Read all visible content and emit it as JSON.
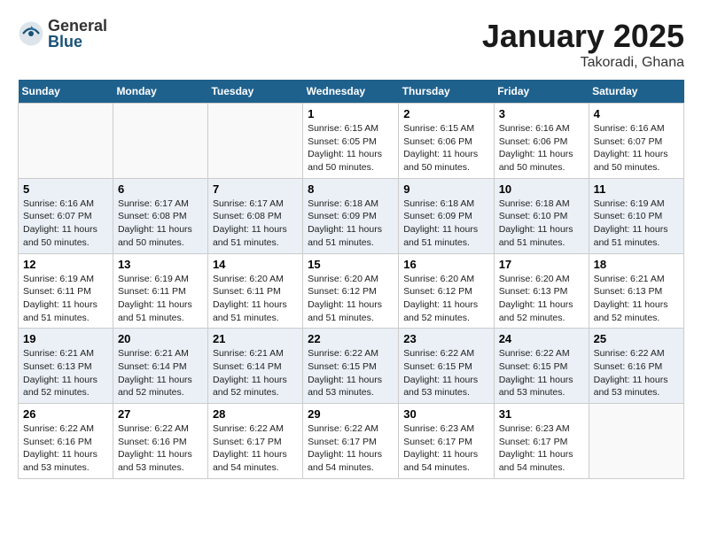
{
  "header": {
    "logo_general": "General",
    "logo_blue": "Blue",
    "month_title": "January 2025",
    "location": "Takoradi, Ghana"
  },
  "days_of_week": [
    "Sunday",
    "Monday",
    "Tuesday",
    "Wednesday",
    "Thursday",
    "Friday",
    "Saturday"
  ],
  "weeks": [
    {
      "days": [
        {
          "num": "",
          "info": ""
        },
        {
          "num": "",
          "info": ""
        },
        {
          "num": "",
          "info": ""
        },
        {
          "num": "1",
          "info": "Sunrise: 6:15 AM\nSunset: 6:05 PM\nDaylight: 11 hours\nand 50 minutes."
        },
        {
          "num": "2",
          "info": "Sunrise: 6:15 AM\nSunset: 6:06 PM\nDaylight: 11 hours\nand 50 minutes."
        },
        {
          "num": "3",
          "info": "Sunrise: 6:16 AM\nSunset: 6:06 PM\nDaylight: 11 hours\nand 50 minutes."
        },
        {
          "num": "4",
          "info": "Sunrise: 6:16 AM\nSunset: 6:07 PM\nDaylight: 11 hours\nand 50 minutes."
        }
      ]
    },
    {
      "days": [
        {
          "num": "5",
          "info": "Sunrise: 6:16 AM\nSunset: 6:07 PM\nDaylight: 11 hours\nand 50 minutes."
        },
        {
          "num": "6",
          "info": "Sunrise: 6:17 AM\nSunset: 6:08 PM\nDaylight: 11 hours\nand 50 minutes."
        },
        {
          "num": "7",
          "info": "Sunrise: 6:17 AM\nSunset: 6:08 PM\nDaylight: 11 hours\nand 51 minutes."
        },
        {
          "num": "8",
          "info": "Sunrise: 6:18 AM\nSunset: 6:09 PM\nDaylight: 11 hours\nand 51 minutes."
        },
        {
          "num": "9",
          "info": "Sunrise: 6:18 AM\nSunset: 6:09 PM\nDaylight: 11 hours\nand 51 minutes."
        },
        {
          "num": "10",
          "info": "Sunrise: 6:18 AM\nSunset: 6:10 PM\nDaylight: 11 hours\nand 51 minutes."
        },
        {
          "num": "11",
          "info": "Sunrise: 6:19 AM\nSunset: 6:10 PM\nDaylight: 11 hours\nand 51 minutes."
        }
      ]
    },
    {
      "days": [
        {
          "num": "12",
          "info": "Sunrise: 6:19 AM\nSunset: 6:11 PM\nDaylight: 11 hours\nand 51 minutes."
        },
        {
          "num": "13",
          "info": "Sunrise: 6:19 AM\nSunset: 6:11 PM\nDaylight: 11 hours\nand 51 minutes."
        },
        {
          "num": "14",
          "info": "Sunrise: 6:20 AM\nSunset: 6:11 PM\nDaylight: 11 hours\nand 51 minutes."
        },
        {
          "num": "15",
          "info": "Sunrise: 6:20 AM\nSunset: 6:12 PM\nDaylight: 11 hours\nand 51 minutes."
        },
        {
          "num": "16",
          "info": "Sunrise: 6:20 AM\nSunset: 6:12 PM\nDaylight: 11 hours\nand 52 minutes."
        },
        {
          "num": "17",
          "info": "Sunrise: 6:20 AM\nSunset: 6:13 PM\nDaylight: 11 hours\nand 52 minutes."
        },
        {
          "num": "18",
          "info": "Sunrise: 6:21 AM\nSunset: 6:13 PM\nDaylight: 11 hours\nand 52 minutes."
        }
      ]
    },
    {
      "days": [
        {
          "num": "19",
          "info": "Sunrise: 6:21 AM\nSunset: 6:13 PM\nDaylight: 11 hours\nand 52 minutes."
        },
        {
          "num": "20",
          "info": "Sunrise: 6:21 AM\nSunset: 6:14 PM\nDaylight: 11 hours\nand 52 minutes."
        },
        {
          "num": "21",
          "info": "Sunrise: 6:21 AM\nSunset: 6:14 PM\nDaylight: 11 hours\nand 52 minutes."
        },
        {
          "num": "22",
          "info": "Sunrise: 6:22 AM\nSunset: 6:15 PM\nDaylight: 11 hours\nand 53 minutes."
        },
        {
          "num": "23",
          "info": "Sunrise: 6:22 AM\nSunset: 6:15 PM\nDaylight: 11 hours\nand 53 minutes."
        },
        {
          "num": "24",
          "info": "Sunrise: 6:22 AM\nSunset: 6:15 PM\nDaylight: 11 hours\nand 53 minutes."
        },
        {
          "num": "25",
          "info": "Sunrise: 6:22 AM\nSunset: 6:16 PM\nDaylight: 11 hours\nand 53 minutes."
        }
      ]
    },
    {
      "days": [
        {
          "num": "26",
          "info": "Sunrise: 6:22 AM\nSunset: 6:16 PM\nDaylight: 11 hours\nand 53 minutes."
        },
        {
          "num": "27",
          "info": "Sunrise: 6:22 AM\nSunset: 6:16 PM\nDaylight: 11 hours\nand 53 minutes."
        },
        {
          "num": "28",
          "info": "Sunrise: 6:22 AM\nSunset: 6:17 PM\nDaylight: 11 hours\nand 54 minutes."
        },
        {
          "num": "29",
          "info": "Sunrise: 6:22 AM\nSunset: 6:17 PM\nDaylight: 11 hours\nand 54 minutes."
        },
        {
          "num": "30",
          "info": "Sunrise: 6:23 AM\nSunset: 6:17 PM\nDaylight: 11 hours\nand 54 minutes."
        },
        {
          "num": "31",
          "info": "Sunrise: 6:23 AM\nSunset: 6:17 PM\nDaylight: 11 hours\nand 54 minutes."
        },
        {
          "num": "",
          "info": ""
        }
      ]
    }
  ]
}
